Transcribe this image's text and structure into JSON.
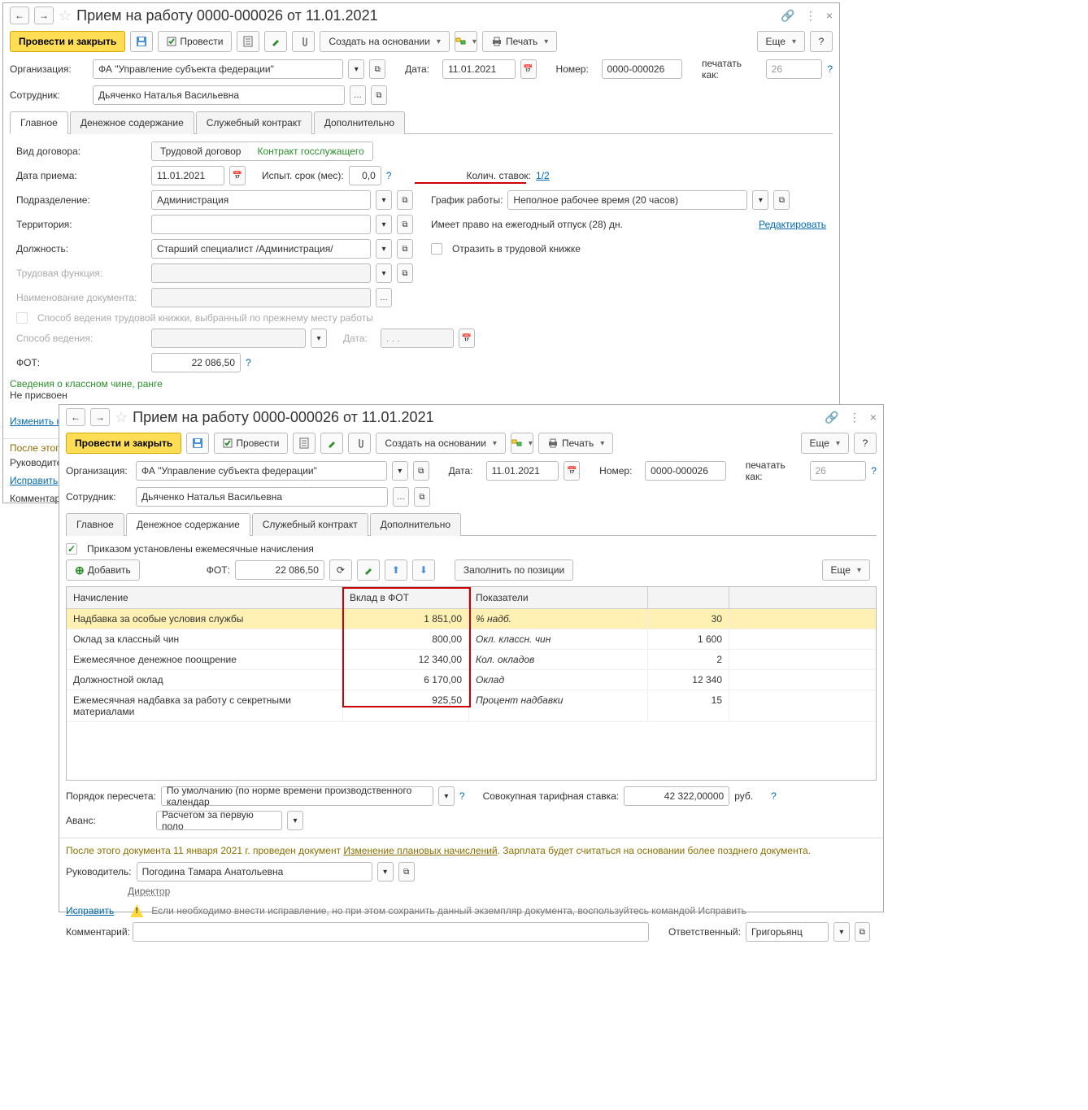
{
  "window_title": "Прием на работу 0000-000026 от 11.01.2021",
  "toolbar": {
    "conduct_close": "Провести и закрыть",
    "conduct": "Провести",
    "create_based": "Создать на основании",
    "print": "Печать",
    "more": "Еще"
  },
  "form": {
    "org_label": "Организация:",
    "org_value": "ФА \"Управление субъекта федерации\"",
    "date_label": "Дата:",
    "date_value": "11.01.2021",
    "number_label": "Номер:",
    "number_value": "0000-000026",
    "print_as_label": "печатать как:",
    "print_as_value": "26",
    "employee_label": "Сотрудник:",
    "employee_value": "Дьяченко Наталья Васильевна"
  },
  "tabs": [
    "Главное",
    "Денежное содержание",
    "Служебный контракт",
    "Дополнительно"
  ],
  "main_tab": {
    "contract_type_label": "Вид договора:",
    "contract_type_labor": "Трудовой договор",
    "contract_type_gov": "Контракт госслужащего",
    "receipt_date_label": "Дата приема:",
    "receipt_date": "11.01.2021",
    "probation_label": "Испыт. срок (мес):",
    "probation_value": "0,0",
    "rates_label": "Колич. ставок:",
    "rates_value": "1/2",
    "schedule_label": "График работы:",
    "schedule_value": "Неполное рабочее время (20 часов)",
    "vacation_text": "Имеет право на ежегодный отпуск (28) дн.",
    "edit_link": "Редактировать",
    "reflect_label": "Отразить в трудовой книжке",
    "division_label": "Подразделение:",
    "division_value": "Администрация",
    "territory_label": "Территория:",
    "position_label": "Должность:",
    "position_value": "Старший специалист /Администрация/",
    "labor_func_label": "Трудовая функция:",
    "doc_name_label": "Наименование документа:",
    "book_method_text": "Способ ведения трудовой книжки, выбранный по прежнему месту работы",
    "method_label": "Способ ведения:",
    "date2_label": "Дата:",
    "date2_placeholder": ". . .",
    "fot_label": "ФОТ:",
    "fot_value": "22 086,50",
    "rank_info_label": "Сведения о классном чине, ранге",
    "rank_not_assigned": "Не присвоен",
    "change_rank_link": "Изменить классный чин, ранг",
    "after_doc_prefix": "После этого",
    "manager_prefix": "Руководитель",
    "fix_link": "Исправить",
    "comment_prefix": "Комментари"
  },
  "money_tab": {
    "order_established": "Приказом установлены ежемесячные начисления",
    "add_btn": "Добавить",
    "fot_label": "ФОТ:",
    "fot_value": "22 086,50",
    "fill_position": "Заполнить по позиции",
    "more": "Еще",
    "headers": [
      "Начисление",
      "Вклад в ФОТ",
      "Показатели"
    ],
    "rows": [
      {
        "name": "Надбавка за особые условия службы",
        "fot": "1 851,00",
        "indicator": "% надб.",
        "ind_val": "30"
      },
      {
        "name": "Оклад за классный чин",
        "fot": "800,00",
        "indicator": "Окл. классн. чин",
        "ind_val": "1 600"
      },
      {
        "name": "Ежемесячное денежное поощрение",
        "fot": "12 340,00",
        "indicator": "Кол. окладов",
        "ind_val": "2"
      },
      {
        "name": "Должностной оклад",
        "fot": "6 170,00",
        "indicator": "Оклад",
        "ind_val": "12 340"
      },
      {
        "name": "Ежемесячная надбавка за работу с секретными материалами",
        "fot": "925,50",
        "indicator": "Процент надбавки",
        "ind_val": "15"
      }
    ],
    "recalc_order_label": "Порядок пересчета:",
    "recalc_order_value": "По умолчанию (по норме времени производственного календар",
    "total_rate_label": "Совокупная тарифная ставка:",
    "total_rate_value": "42 322,00000",
    "rub": "руб.",
    "advance_label": "Аванс:",
    "advance_value": "Расчетом за первую поло"
  },
  "footer": {
    "after_doc_text_pre": "После этого документа 11 января 2021 г. проведен документ ",
    "after_doc_link": "Изменение плановых начислений",
    "after_doc_text_post": ". Зарплата будет считаться на основании более позднего документа.",
    "manager_label": "Руководитель:",
    "manager_value": "Погодина Тамара Анатольевна",
    "director_link": "Директор",
    "fix_link": "Исправить",
    "fix_text": "Если необходимо внести исправление, но при этом сохранить данный экземпляр документа, воспользуйтесь командой Исправить",
    "comment_label": "Комментарий:",
    "responsible_label": "Ответственный:",
    "responsible_value": "Григорьянц"
  }
}
